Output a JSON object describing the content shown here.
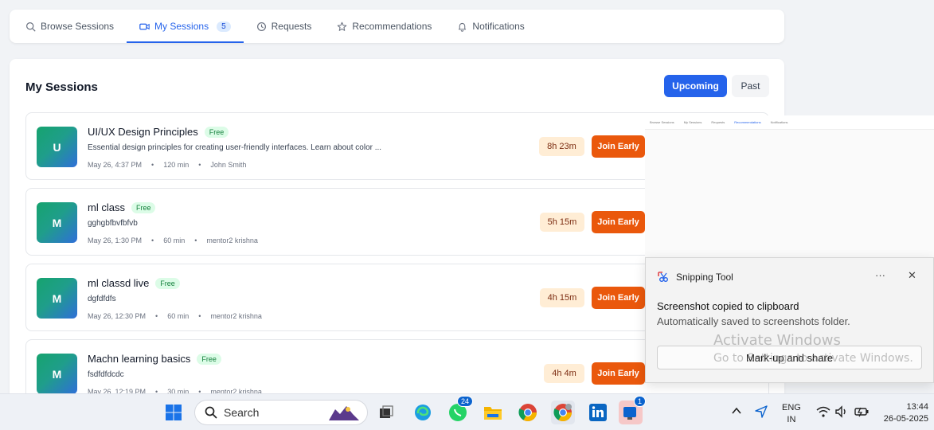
{
  "nav": {
    "tabs": [
      {
        "label": "Browse Sessions",
        "icon": "search-icon"
      },
      {
        "label": "My Sessions",
        "icon": "video-icon",
        "badge": "5",
        "active": true
      },
      {
        "label": "Requests",
        "icon": "clock-icon"
      },
      {
        "label": "Recommendations",
        "icon": "star-icon"
      },
      {
        "label": "Notifications",
        "icon": "bell-icon"
      }
    ]
  },
  "main": {
    "title": "My Sessions",
    "upcoming_label": "Upcoming",
    "past_label": "Past"
  },
  "sessions": [
    {
      "initial": "U",
      "title": "UI/UX Design Principles",
      "badge": "Free",
      "description": "Essential design principles for creating user-friendly interfaces. Learn about color ...",
      "date": "May 26, 4:37 PM",
      "duration": "120 min",
      "mentor": "John Smith",
      "countdown": "8h 23m",
      "action": "Join Early"
    },
    {
      "initial": "M",
      "title": "ml class",
      "badge": "Free",
      "description": "gghgbfbvfbfvb",
      "date": "May 26, 1:30 PM",
      "duration": "60 min",
      "mentor": "mentor2 krishna",
      "countdown": "5h 15m",
      "action": "Join Early"
    },
    {
      "initial": "M",
      "title": "ml classd live",
      "badge": "Free",
      "description": "dgfdfdfs",
      "date": "May 26, 12:30 PM",
      "duration": "60 min",
      "mentor": "mentor2 krishna",
      "countdown": "4h 15m",
      "action": "Join Early"
    },
    {
      "initial": "M",
      "title": "Machn learning basics",
      "badge": "Free",
      "description": "fsdfdfdcdc",
      "date": "May 26, 12:19 PM",
      "duration": "30 min",
      "mentor": "mentor2 krishna",
      "countdown": "4h 4m",
      "action": "Join Early"
    }
  ],
  "meta_separator": "•",
  "preview_nav": [
    "Browse Sessions",
    "My Sessions",
    "Requests",
    "Recommendations",
    "Notifications"
  ],
  "toast": {
    "app": "Snipping Tool",
    "more": "···",
    "close": "✕",
    "title": "Screenshot copied to clipboard",
    "subtitle": "Automatically saved to screenshots folder.",
    "button": "Mark-up and share"
  },
  "watermark": {
    "line1": "Activate Windows",
    "line2": "Go to Settings to activate Windows."
  },
  "taskbar": {
    "search_placeholder": "Search",
    "whatsapp_badge": "24",
    "teams_badge": "1",
    "lang": "ENG",
    "region": "IN",
    "time": "13:44",
    "date": "26-05-2025"
  },
  "colors": {
    "primary": "#2563eb",
    "join": "#ea580c",
    "timer_bg": "#ffedd5",
    "free_bg": "#dcfce7"
  }
}
